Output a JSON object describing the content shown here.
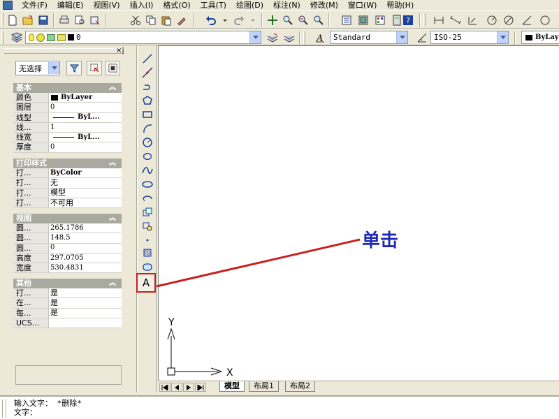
{
  "menubar": {
    "items": [
      "文件(F)",
      "编辑(E)",
      "视图(V)",
      "插入(I)",
      "格式(O)",
      "工具(T)",
      "绘图(D)",
      "标注(N)",
      "修改(M)",
      "窗口(W)",
      "帮助(H)"
    ]
  },
  "layers_toolbar": {
    "layer_value": "0"
  },
  "styles_toolbar": {
    "text_style": "Standard",
    "dim_style": "ISO-25",
    "bylayer_value": "ByLay"
  },
  "palette": {
    "selection": "无选择",
    "sections": [
      {
        "title": "基本",
        "rows": [
          {
            "name": "颜色",
            "value": "ByLayer",
            "kind": "color"
          },
          {
            "name": "图层",
            "value": "0",
            "kind": "text"
          },
          {
            "name": "线型",
            "value": "ByL...",
            "kind": "line"
          },
          {
            "name": "线...",
            "value": "1",
            "kind": "text"
          },
          {
            "name": "线宽",
            "value": "ByL...",
            "kind": "line"
          },
          {
            "name": "厚度",
            "value": "0",
            "kind": "text"
          }
        ]
      },
      {
        "title": "打印样式",
        "rows": [
          {
            "name": "打...",
            "value": "ByColor",
            "kind": "text"
          },
          {
            "name": "打...",
            "value": "无",
            "kind": "text"
          },
          {
            "name": "打...",
            "value": "模型",
            "kind": "text"
          },
          {
            "name": "打...",
            "value": "不可用",
            "kind": "text"
          }
        ]
      },
      {
        "title": "视图",
        "rows": [
          {
            "name": "圆...",
            "value": "265.1786",
            "kind": "text"
          },
          {
            "name": "圆...",
            "value": "148.5",
            "kind": "text"
          },
          {
            "name": "圆...",
            "value": "0",
            "kind": "text"
          },
          {
            "name": "高度",
            "value": "297.0705",
            "kind": "text"
          },
          {
            "name": "宽度",
            "value": "530.4831",
            "kind": "text"
          }
        ]
      },
      {
        "title": "其他",
        "rows": [
          {
            "name": "打...",
            "value": "是",
            "kind": "text"
          },
          {
            "name": "在...",
            "value": "是",
            "kind": "text"
          },
          {
            "name": "每...",
            "value": "是",
            "kind": "text"
          },
          {
            "name": "UCS...",
            "value": "",
            "kind": "text"
          }
        ]
      }
    ]
  },
  "draw_toolbar": {
    "text_tool_glyph": "A"
  },
  "ucs": {
    "x_label": "X",
    "y_label": "Y"
  },
  "tabs": [
    {
      "label": "模型",
      "active": true
    },
    {
      "label": "布局1",
      "active": false
    },
    {
      "label": "布局2",
      "active": false
    }
  ],
  "command_line": {
    "line1": "输入文字： *删除*",
    "line2": "文字："
  },
  "annotation": {
    "label": "单击",
    "color": "#c8201e"
  }
}
